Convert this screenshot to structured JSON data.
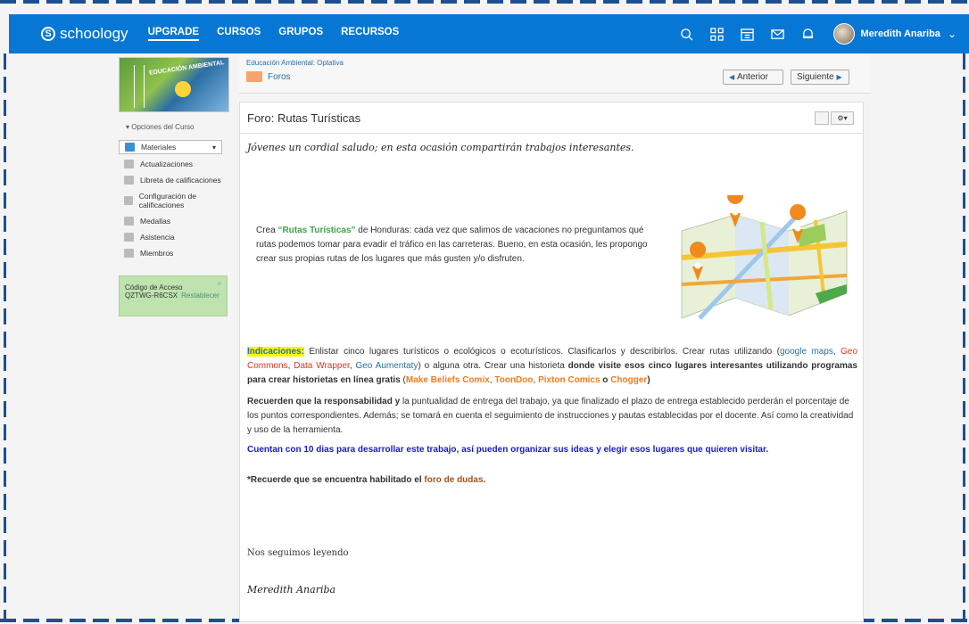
{
  "topbar": {
    "logo": "schoology",
    "nav": [
      "UPGRADE",
      "CURSOS",
      "GRUPOS",
      "RECURSOS"
    ],
    "user_name": "Meredith Anariba",
    "icons": [
      "search-icon",
      "apps-grid-icon",
      "calendar-icon",
      "mail-icon",
      "notification-bell-icon"
    ]
  },
  "sidebar": {
    "course_image_text": "EDUCACIÓN AMBIENTAL",
    "course_options": "Opciones del Curso",
    "active_item": "Materiales",
    "items": [
      "Actualizaciones",
      "Libreta de calificaciones",
      "Configuración de calificaciones",
      "Medallas",
      "Asistencia",
      "Miembros"
    ],
    "access": {
      "title": "Código de Acceso",
      "code": "QZTWG-R6CSX",
      "reset": "Restablecer"
    }
  },
  "header": {
    "breadcrumb": "Educación Ambiental: Optativa",
    "folder": "Foros",
    "prev": "Anterior",
    "next": "Siguiente"
  },
  "post": {
    "title": "Foro: Rutas Turísticas",
    "greeting": "Jóvenes un cordial saludo; en esta ocasión compartirán trabajos interesantes.",
    "intro_prefix": "Crea ",
    "intro_highlight": "“Rutas Turísticas”",
    "intro_rest": " de Honduras: cada vez que salimos de vacaciones no preguntamos qué rutas podemos tomar para evadir el tráfico en las carreteras. Bueno, en esta ocasión, les propongo crear sus propias rutas de los lugares que más gusten y/o disfruten.",
    "indicaciones_label": "Indicaciones:",
    "ind_1": " Enlistar cinco lugares turísticos o ecológicos o ecoturísticos. Clasificarlos y describirlos. Crear rutas utilizando (",
    "link_google": "google maps",
    "sep1": ", ",
    "link_geo": "Geo Commons",
    "sep2": ", ",
    "link_data": "Data Wrapper",
    "sep3": ", ",
    "link_aumentaty": "Geo Aumentaty",
    "ind_2": ") o alguna otra. Crear una historieta ",
    "ind_bold": "donde visite esos cinco lugares interesantes utilizando programas para crear historietas en línea gratis",
    "ind_3": " (",
    "link_make": "Make Beliefs Comix",
    "sep4": ", ",
    "link_toon": "ToonDoo",
    "sep5": ", ",
    "link_pixton": "Pixton Comics",
    "sep6": " o ",
    "link_chogger": "Chogger",
    "ind_end": ")",
    "resp_bold": "Recuerden que la responsabilidad y",
    "resp_rest": " la puntualidad de entrega del trabajo, ya que finalizado el plazo de entrega establecido perderán el porcentaje de los puntos correspondientes. Además; se tomará en cuenta el seguimiento de instrucciones y pautas establecidas por el docente. Así como la creatividad y uso de la herramienta.",
    "days": "Cuentan con 10 dias para desarrollar este trabajo, así pueden organizar sus ideas y elegir esos lugares que quieren visitar.",
    "reminder_prefix": "*Recuerde que se encuentra habilitado el ",
    "reminder_link": "foro de dudas",
    "reminder_end": ".",
    "closing": "Nos seguimos leyendo",
    "signature": "Meredith Anariba"
  }
}
